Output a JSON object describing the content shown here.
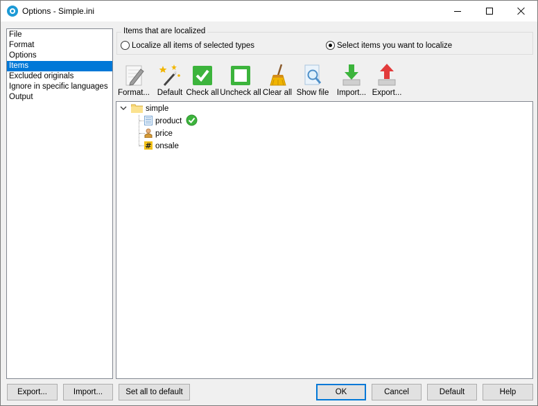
{
  "window": {
    "title": "Options - Simple.ini",
    "minimize_label": "",
    "maximize_label": "",
    "close_label": ""
  },
  "sidebar": {
    "items": [
      {
        "label": "File",
        "selected": false
      },
      {
        "label": "Format",
        "selected": false
      },
      {
        "label": "Options",
        "selected": false
      },
      {
        "label": "Items",
        "selected": true
      },
      {
        "label": "Excluded originals",
        "selected": false
      },
      {
        "label": "Ignore in specific languages",
        "selected": false
      },
      {
        "label": "Output",
        "selected": false
      }
    ]
  },
  "localize_group": {
    "title": "Items that are localized",
    "option_all": "Localize all items of selected types",
    "option_select": "Select items you want to localize",
    "selected": "option_select"
  },
  "toolbar": {
    "buttons": [
      {
        "label": "Format...",
        "icon": "pencil-icon"
      },
      {
        "label": "Default",
        "icon": "magic-wand-icon"
      },
      {
        "label": "Check all",
        "icon": "check-all-icon"
      },
      {
        "label": "Uncheck all",
        "icon": "uncheck-all-icon"
      },
      {
        "label": "Clear all",
        "icon": "broom-icon"
      },
      {
        "label": "Show file",
        "icon": "magnifier-icon"
      },
      {
        "label": "Import...",
        "icon": "import-arrow-icon"
      },
      {
        "label": "Export...",
        "icon": "export-arrow-icon"
      }
    ]
  },
  "tree": {
    "root": {
      "label": "simple",
      "icon": "folder-icon",
      "expanded": true
    },
    "children": [
      {
        "label": "product",
        "icon": "string-list-icon",
        "checked": true
      },
      {
        "label": "price",
        "icon": "person-icon",
        "checked": false
      },
      {
        "label": "onsale",
        "icon": "hash-icon",
        "checked": false
      }
    ]
  },
  "footer": {
    "export": "Export...",
    "import": "Import...",
    "set_all_default": "Set all to default",
    "ok": "OK",
    "cancel": "Cancel",
    "default": "Default",
    "help": "Help"
  },
  "colors": {
    "selection": "#0078d7",
    "check_green": "#3cb43c"
  }
}
